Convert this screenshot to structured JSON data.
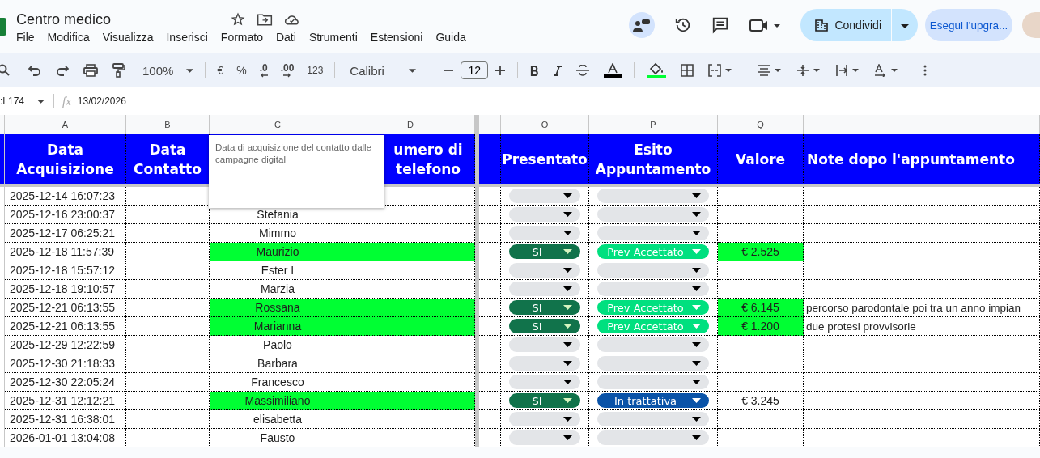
{
  "document": {
    "title": "Centro medico"
  },
  "menu": [
    "File",
    "Modifica",
    "Visualizza",
    "Inserisci",
    "Formato",
    "Dati",
    "Strumenti",
    "Estensioni",
    "Guida"
  ],
  "share_button": "Condividi",
  "upgrade_button": "Esegui l'upgra...",
  "toolbar": {
    "zoom": "100%",
    "currency": "€",
    "percent": "%",
    "decrease_decimals": ".0",
    "increase_decimals": ".00",
    "number_format": "123",
    "font": "Calibri",
    "font_size": "12"
  },
  "formula_bar": {
    "name_box": ":L174",
    "function_label": "fx",
    "value": "13/02/2026"
  },
  "column_letters": [
    "A",
    "B",
    "C",
    "D",
    "O",
    "P",
    "Q"
  ],
  "headers": [
    {
      "text": "Data Acquisizione"
    },
    {
      "text": "Data Contatto"
    },
    {
      "text": "umero di telefono"
    },
    {
      "text": "Presentato"
    },
    {
      "text": "Esito Appuntamento"
    },
    {
      "text": "Valore"
    },
    {
      "text": "Note dopo l'appuntamento"
    }
  ],
  "note": {
    "text": "Data di acquisizione del contatto dalle campagne digital"
  },
  "rows": [
    {
      "date": "2025-12-14 16:07:23",
      "highlight": false,
      "presentato": {
        "color": "#e3e5e8"
      },
      "esito": {
        "color": "#e3e5e8"
      }
    },
    {
      "date": "2025-12-16 23:00:37",
      "name": "Stefania",
      "highlight": false,
      "presentato": {
        "color": "#e3e5e8"
      },
      "esito": {
        "color": "#e3e5e8"
      }
    },
    {
      "date": "2025-12-17 06:25:21",
      "name": "Mimmo",
      "highlight": false,
      "presentato": {
        "color": "#e3e5e8"
      },
      "esito": {
        "color": "#e3e5e8"
      }
    },
    {
      "date": "2025-12-18 11:57:39",
      "name": "Maurizio",
      "highlight": true,
      "presentato": {
        "text": "SI",
        "color": "#11734b"
      },
      "esito": {
        "text": "Prev Accettato",
        "color": "#00e07f"
      },
      "valore": "€ 2.525",
      "valore_highlight": true
    },
    {
      "date": "2025-12-18 15:57:12",
      "name": "Ester I",
      "highlight": false,
      "presentato": {
        "color": "#e3e5e8"
      },
      "esito": {
        "color": "#e3e5e8"
      }
    },
    {
      "date": "2025-12-18 19:10:57",
      "name": "Marzia",
      "highlight": false,
      "presentato": {
        "color": "#e3e5e8"
      },
      "esito": {
        "color": "#e3e5e8"
      }
    },
    {
      "date": "2025-12-21 06:13:55",
      "name": "Rossana",
      "highlight": true,
      "presentato": {
        "text": "SI",
        "color": "#11734b"
      },
      "esito": {
        "text": "Prev Accettato",
        "color": "#00e07f"
      },
      "valore": "€ 6.145",
      "valore_highlight": true,
      "note": "percorso parodontale poi tra un anno impian"
    },
    {
      "date": "2025-12-21 06:13:55",
      "name": "Marianna",
      "highlight": true,
      "presentato": {
        "text": "SI",
        "color": "#11734b"
      },
      "esito": {
        "text": "Prev Accettato",
        "color": "#00e07f"
      },
      "valore": "€ 1.200",
      "valore_highlight": true,
      "note": "due protesi provvisorie"
    },
    {
      "date": "2025-12-29 12:22:59",
      "name": "Paolo",
      "highlight": false,
      "presentato": {
        "color": "#e3e5e8"
      },
      "esito": {
        "color": "#e3e5e8"
      }
    },
    {
      "date": "2025-12-30 21:18:33",
      "name": "Barbara",
      "highlight": false,
      "presentato": {
        "color": "#e3e5e8"
      },
      "esito": {
        "color": "#e3e5e8"
      }
    },
    {
      "date": "2025-12-30 22:05:24",
      "name": "Francesco",
      "highlight": false,
      "presentato": {
        "color": "#e3e5e8"
      },
      "esito": {
        "color": "#e3e5e8"
      }
    },
    {
      "date": "2025-12-31 12:12:21",
      "name": "Massimiliano",
      "highlight": true,
      "presentato": {
        "text": "SI",
        "color": "#11734b"
      },
      "esito": {
        "text": "In trattativa",
        "color": "#0a53a8"
      },
      "valore": "€ 3.245",
      "valore_highlight": false
    },
    {
      "date": "2025-12-31 16:38:01",
      "name": "elisabetta",
      "highlight": false,
      "presentato": {
        "color": "#e3e5e8"
      },
      "esito": {
        "color": "#e3e5e8"
      }
    },
    {
      "date": "2026-01-01 13:04:08",
      "name": "Fausto",
      "highlight": false,
      "presentato": {
        "color": "#e3e5e8"
      },
      "esito": {
        "color": "#e3e5e8"
      }
    }
  ]
}
